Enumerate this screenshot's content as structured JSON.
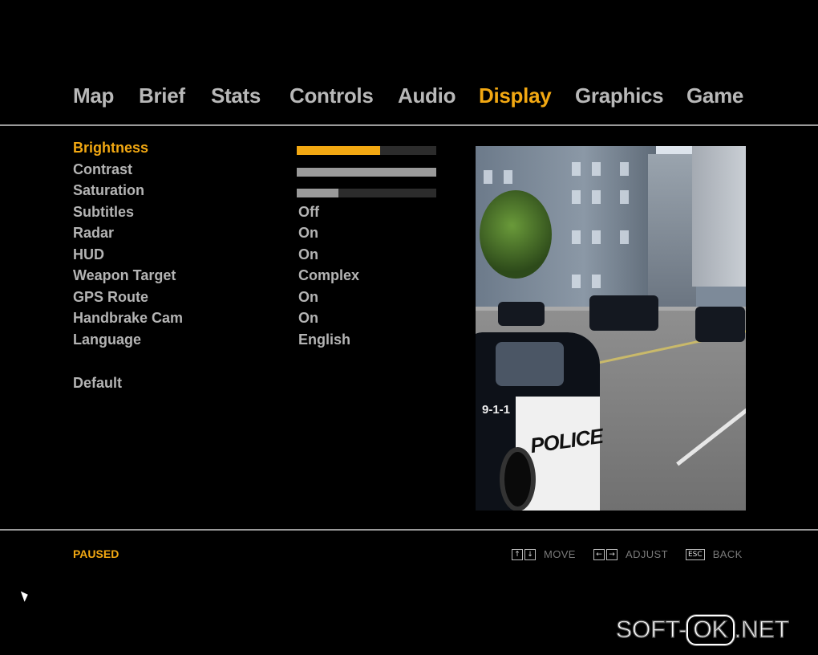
{
  "tabs": [
    {
      "label": "Map",
      "active": false
    },
    {
      "label": "Brief",
      "active": false
    },
    {
      "label": "Stats",
      "active": false
    },
    {
      "label": "Controls",
      "active": false
    },
    {
      "label": "Audio",
      "active": false
    },
    {
      "label": "Display",
      "active": true
    },
    {
      "label": "Graphics",
      "active": false
    },
    {
      "label": "Game",
      "active": false
    }
  ],
  "settings": [
    {
      "label": "Brightness",
      "type": "slider",
      "level": 0.6,
      "selected": true
    },
    {
      "label": "Contrast",
      "type": "slider",
      "level": 1.0
    },
    {
      "label": "Saturation",
      "type": "slider",
      "level": 0.3
    },
    {
      "label": "Subtitles",
      "value": "Off"
    },
    {
      "label": "Radar",
      "value": "On"
    },
    {
      "label": "HUD",
      "value": "On"
    },
    {
      "label": "Weapon Target",
      "value": "Complex"
    },
    {
      "label": "GPS Route",
      "value": "On"
    },
    {
      "label": "Handbrake Cam",
      "value": "On"
    },
    {
      "label": "Language",
      "value": "English"
    }
  ],
  "default_label": "Default",
  "preview": {
    "car_number": "9-1-1",
    "car_text": "POLICE"
  },
  "footer": {
    "status": "PAUSED",
    "hints": [
      {
        "keys": [
          "↑",
          "↓"
        ],
        "label": "MOVE"
      },
      {
        "keys": [
          "←",
          "→"
        ],
        "label": "ADJUST"
      },
      {
        "keys": [
          "ESC"
        ],
        "label": "BACK"
      }
    ]
  },
  "watermark": {
    "left": "SOFT-",
    "box": "OK",
    "right": ".NET"
  },
  "colors": {
    "accent": "#f2a812",
    "text": "#b4b4b4",
    "background": "#000000"
  }
}
